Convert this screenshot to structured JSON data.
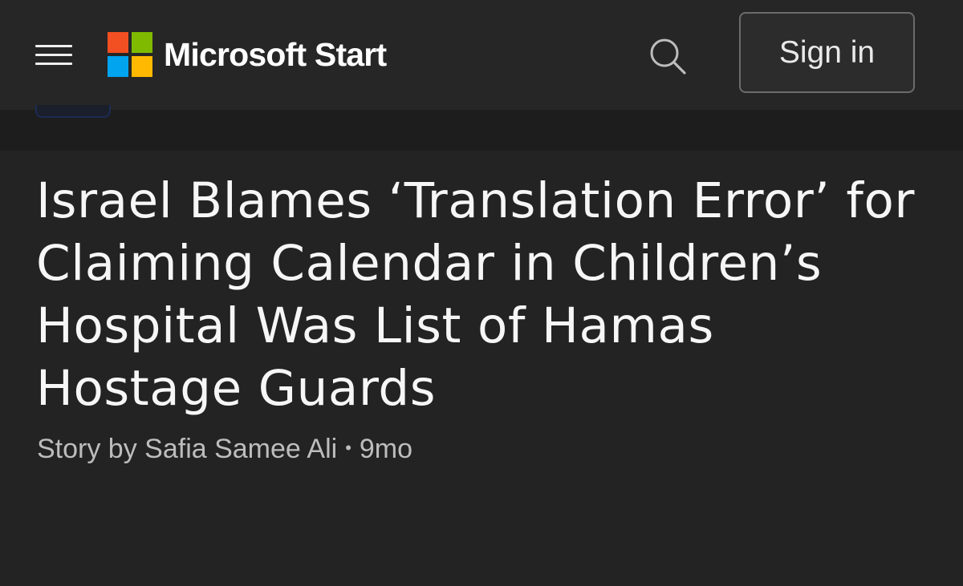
{
  "header": {
    "brand_name": "Microsoft Start",
    "signin_label": "Sign in",
    "logo_colors": [
      "#f25022",
      "#7fba00",
      "#00a4ef",
      "#ffb900"
    ],
    "icons": {
      "menu": "hamburger-menu-icon",
      "search": "search-icon"
    }
  },
  "article": {
    "headline": "Israel Blames ‘Translation Error’ for Claiming Calendar in Children’s Hospital Was List of Hamas Hostage Guards",
    "byline_author": "Story by Safia Samee Ali",
    "byline_separator": "•",
    "byline_age": "9mo"
  },
  "colors": {
    "background": "#232323",
    "topbar": "#262626",
    "subbar": "#1d1d1d",
    "headline_text": "#f6f6f6",
    "byline_text": "#bdbdbd"
  }
}
